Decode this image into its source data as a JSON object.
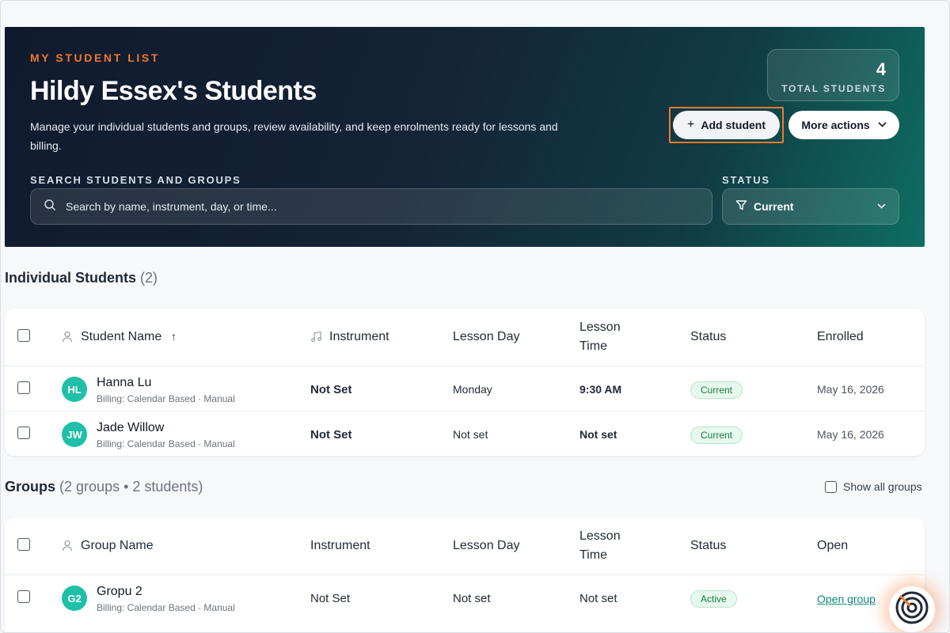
{
  "hero": {
    "eyebrow": "MY STUDENT LIST",
    "title": "Hildy Essex's Students",
    "description": "Manage your individual students and groups, review availability, and keep enrolments ready for lessons and billing.",
    "stat_value": "4",
    "stat_label": "TOTAL STUDENTS",
    "add_student_label": "Add student",
    "more_actions_label": "More actions",
    "search_label": "SEARCH STUDENTS AND GROUPS",
    "search_placeholder": "Search by name, instrument, day, or time...",
    "search_value": "",
    "status_label": "STATUS",
    "status_value": "Current"
  },
  "individuals": {
    "title": "Individual Students",
    "count": "(2)",
    "columns": {
      "name": "Student Name",
      "instrument": "Instrument",
      "day": "Lesson Day",
      "time_line1": "Lesson",
      "time_line2": "Time",
      "status": "Status",
      "enrolled": "Enrolled"
    },
    "rows": [
      {
        "initials": "HL",
        "name": "Hanna Lu",
        "billing": "Billing: Calendar Based · Manual",
        "instrument": "Not Set",
        "day": "Monday",
        "time": "9:30 AM",
        "status": "Current",
        "enrolled": "May 16, 2026"
      },
      {
        "initials": "JW",
        "name": "Jade Willow",
        "billing": "Billing: Calendar Based · Manual",
        "instrument": "Not Set",
        "day": "Not set",
        "time": "Not set",
        "status": "Current",
        "enrolled": "May 16, 2026"
      }
    ]
  },
  "groups": {
    "title": "Groups",
    "count": "(2 groups • 2 students)",
    "show_all_label": "Show all groups",
    "columns": {
      "name": "Group Name",
      "instrument": "Instrument",
      "day": "Lesson Day",
      "time_line1": "Lesson",
      "time_line2": "Time",
      "status": "Status",
      "open": "Open"
    },
    "rows": [
      {
        "initials": "G2",
        "name": "Gropu 2",
        "billing": "Billing: Calendar Based · Manual",
        "instrument": "Not Set",
        "day": "Not set",
        "time": "Not set",
        "status": "Active",
        "open_label": "Open group"
      }
    ]
  },
  "colors": {
    "accent": "#f0782a",
    "teal": "#1fbfa8",
    "link": "#0f8a78"
  },
  "icons": {
    "plus": "plus-icon",
    "chevron": "chevron-down-icon",
    "search": "search-icon",
    "filter": "filter-icon",
    "user": "user-icon",
    "music": "music-note-icon",
    "sort": "sort-up-icon",
    "fab": "assistant-icon"
  }
}
